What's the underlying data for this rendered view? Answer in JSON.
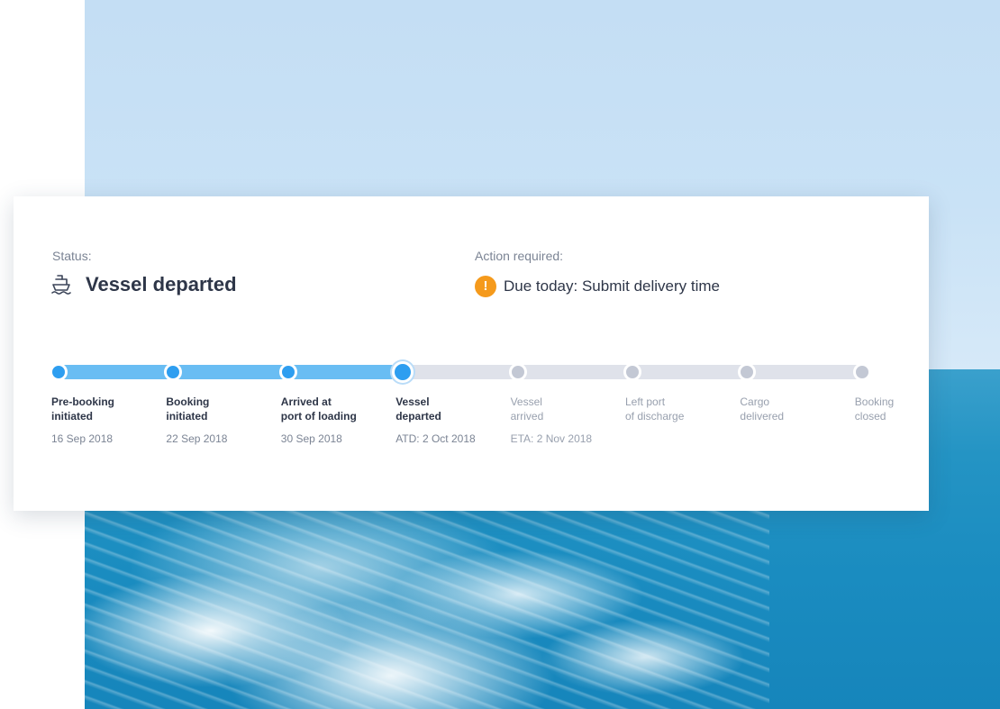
{
  "status": {
    "label": "Status:",
    "title": "Vessel departed",
    "icon": "ship-icon"
  },
  "action": {
    "label": "Action required:",
    "icon": "exclamation-icon",
    "text": "Due today: Submit delivery time",
    "alert_color": "#f59a1c"
  },
  "progress": {
    "completed_steps": 4,
    "total_steps": 8,
    "current_step": 4,
    "fill_color": "#69bdf3",
    "track_color": "#dfe2ea"
  },
  "steps": [
    {
      "line1": "Pre-booking",
      "line2": "initiated",
      "date": "16 Sep 2018",
      "state": "done"
    },
    {
      "line1": "Booking",
      "line2": "initiated",
      "date": "22 Sep 2018",
      "state": "done"
    },
    {
      "line1": "Arrived at",
      "line2": "port of loading",
      "date": "30 Sep 2018",
      "state": "done"
    },
    {
      "line1": "Vessel",
      "line2": "departed",
      "date": "ATD: 2 Oct 2018",
      "state": "current"
    },
    {
      "line1": "Vessel",
      "line2": "arrived",
      "date": "ETA: 2 Nov 2018",
      "state": "todo"
    },
    {
      "line1": "Left port",
      "line2": "of discharge",
      "date": "",
      "state": "todo"
    },
    {
      "line1": "Cargo",
      "line2": "delivered",
      "date": "",
      "state": "todo"
    },
    {
      "line1": "Booking",
      "line2": "closed",
      "date": "",
      "state": "todo"
    }
  ]
}
